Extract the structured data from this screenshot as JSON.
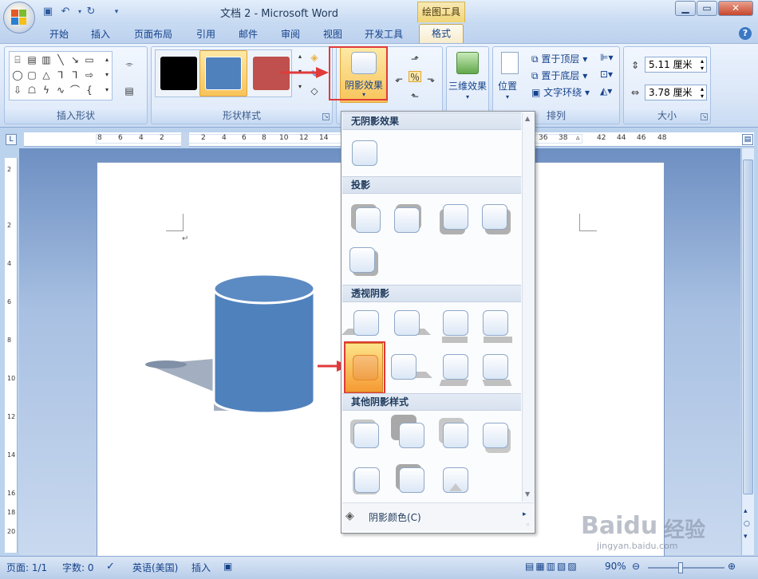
{
  "title_bar": {
    "doc_title": "文档 2 - Microsoft Word",
    "contextual_tools": "绘图工具",
    "qat_items": [
      "save-icon",
      "undo-icon",
      "undo-dropdown-icon",
      "redo-icon",
      "customize-qat-icon"
    ],
    "window_controls": [
      "minimize",
      "restore",
      "close"
    ]
  },
  "tabs": [
    "开始",
    "插入",
    "页面布局",
    "引用",
    "邮件",
    "审阅",
    "视图",
    "开发工具",
    "格式"
  ],
  "active_tab": "格式",
  "ribbon": {
    "insert_shapes": {
      "label": "插入形状"
    },
    "shape_styles": {
      "label": "形状样式",
      "swatches": [
        "#000000",
        "#4f81bd",
        "#c0504d"
      ]
    },
    "shadow_effects": {
      "label": "阴影效果"
    },
    "three_d": {
      "label": "三维效果"
    },
    "arrange": {
      "label": "排列",
      "position": "位置",
      "bring_front": "置于顶层",
      "send_back": "置于底层",
      "wrap": "文字环绕"
    },
    "size": {
      "label": "大小",
      "height": "5.11 厘米",
      "width": "3.78 厘米"
    }
  },
  "ruler": {
    "h_ticks": [
      "8",
      "6",
      "4",
      "2",
      "",
      "2",
      "4",
      "6",
      "8",
      "10",
      "12",
      "14",
      "36",
      "38",
      "",
      "42",
      "44",
      "46",
      "48"
    ],
    "v_ticks": [
      "2",
      "",
      "2",
      "",
      "4",
      "",
      "6",
      "",
      "8",
      "",
      "10",
      "",
      "12",
      "",
      "14",
      "",
      "16",
      "",
      "18",
      "",
      "20"
    ]
  },
  "dropdown": {
    "sections": [
      {
        "title": "无阴影效果"
      },
      {
        "title": "投影"
      },
      {
        "title": "透视阴影"
      },
      {
        "title": "其他阴影样式"
      }
    ],
    "footer": "阴影颜色(C)"
  },
  "status_bar": {
    "page": "页面: 1/1",
    "words": "字数: 0",
    "language": "英语(美国)",
    "mode": "插入",
    "zoom": "90%"
  },
  "watermark": {
    "brand": "Baidu",
    "cn": "经验",
    "url": "jingyan.baidu.com"
  },
  "colors": {
    "accent": "#e03a3a",
    "cylinder": "#4f81bd"
  }
}
